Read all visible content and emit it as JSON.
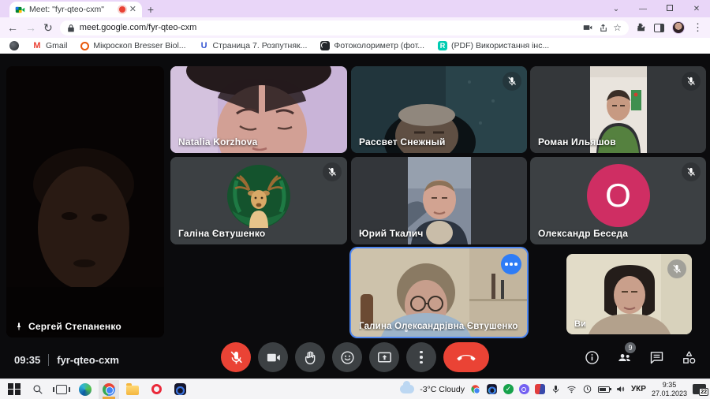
{
  "browser": {
    "tab_title": "Meet: \"fyr-qteo-cxm\"",
    "url": "meet.google.com/fyr-qteo-cxm",
    "bookmarks": [
      {
        "label": "Gmail"
      },
      {
        "label": "Мікроскоп Bresser Biol..."
      },
      {
        "label": "Страница 7. Розпутняк..."
      },
      {
        "label": "Фотоколориметр (фот..."
      },
      {
        "label": "(PDF) Використання інс..."
      }
    ]
  },
  "meet": {
    "status_time": "09:35",
    "meeting_code": "fyr-qteo-cxm",
    "participants_badge": "9",
    "participants": [
      {
        "name": "Сергей Степаненко",
        "pinned": true,
        "muted": false
      },
      {
        "name": "Natalia Korzhova",
        "muted": false
      },
      {
        "name": "Рассвет Снежный",
        "muted": true
      },
      {
        "name": "Роман Ильяшов",
        "muted": true
      },
      {
        "name": "Галіна Євтушенко",
        "muted": true,
        "avatar": "deer-illustration"
      },
      {
        "name": "Юрий Ткалич",
        "muted": false
      },
      {
        "name": "Олександр Беседа",
        "muted": true,
        "avatar_letter": "O",
        "avatar_color": "#cf2e63"
      },
      {
        "name": "Галина Олександрівна Євтушенко",
        "active_speaker": true,
        "muted": false
      },
      {
        "name": "Ви",
        "self_view": true,
        "muted": true
      }
    ],
    "colors": {
      "active_border": "#4e86f0",
      "danger": "#ea4335",
      "tile_gray": "#3c4043"
    }
  },
  "taskbar": {
    "weather": "-3°C Cloudy",
    "language": "УКР",
    "time": "9:35",
    "date": "27.01.2023",
    "notifications": "22"
  }
}
